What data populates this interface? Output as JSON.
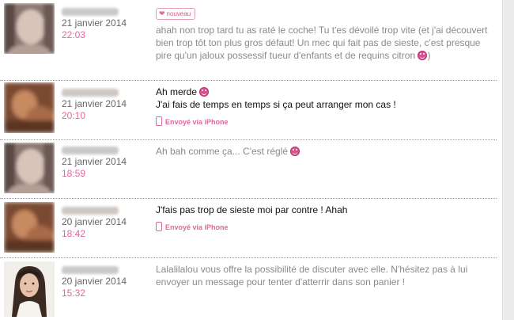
{
  "thread": {
    "messages": [
      {
        "date": "21 janvier 2014",
        "time": "22:03",
        "badge": "nouveau",
        "text": "ahah non trop tard tu as raté le coche! Tu t'es dévoilé trop vite (et j'ai découvert bien trop tôt ton plus gros défaut! Un mec qui fait pas de sieste, c'est presque pire qu'un jaloux possessif tueur d'enfants et de requins citron",
        "emoticon": "smiley-icon"
      },
      {
        "date": "21 janvier 2014",
        "time": "20:10",
        "lines": [
          "Ah merde",
          "J'ai fais de temps en temps si ça peut arranger mon cas !"
        ],
        "via": "Envoyé via iPhone",
        "emoticon": "smiley-icon"
      },
      {
        "date": "21 janvier 2014",
        "time": "18:59",
        "text": "Ah bah comme ça... C'est réglé",
        "emoticon": "smiley-icon"
      },
      {
        "date": "20 janvier 2014",
        "time": "18:42",
        "text": "J'fais pas trop de sieste moi par contre ! Ahah",
        "via": "Envoyé via iPhone"
      },
      {
        "date": "20 janvier 2014",
        "time": "15:32",
        "text": "Lalalilalou vous offre la possibilité de discuter avec elle. N'hésitez pas à lui envoyer un message pour tenter d'atterrir dans son panier !"
      }
    ]
  },
  "colors": {
    "accent": "#e0689e",
    "muted_text": "#8a8a8a",
    "body_text": "#111111"
  }
}
